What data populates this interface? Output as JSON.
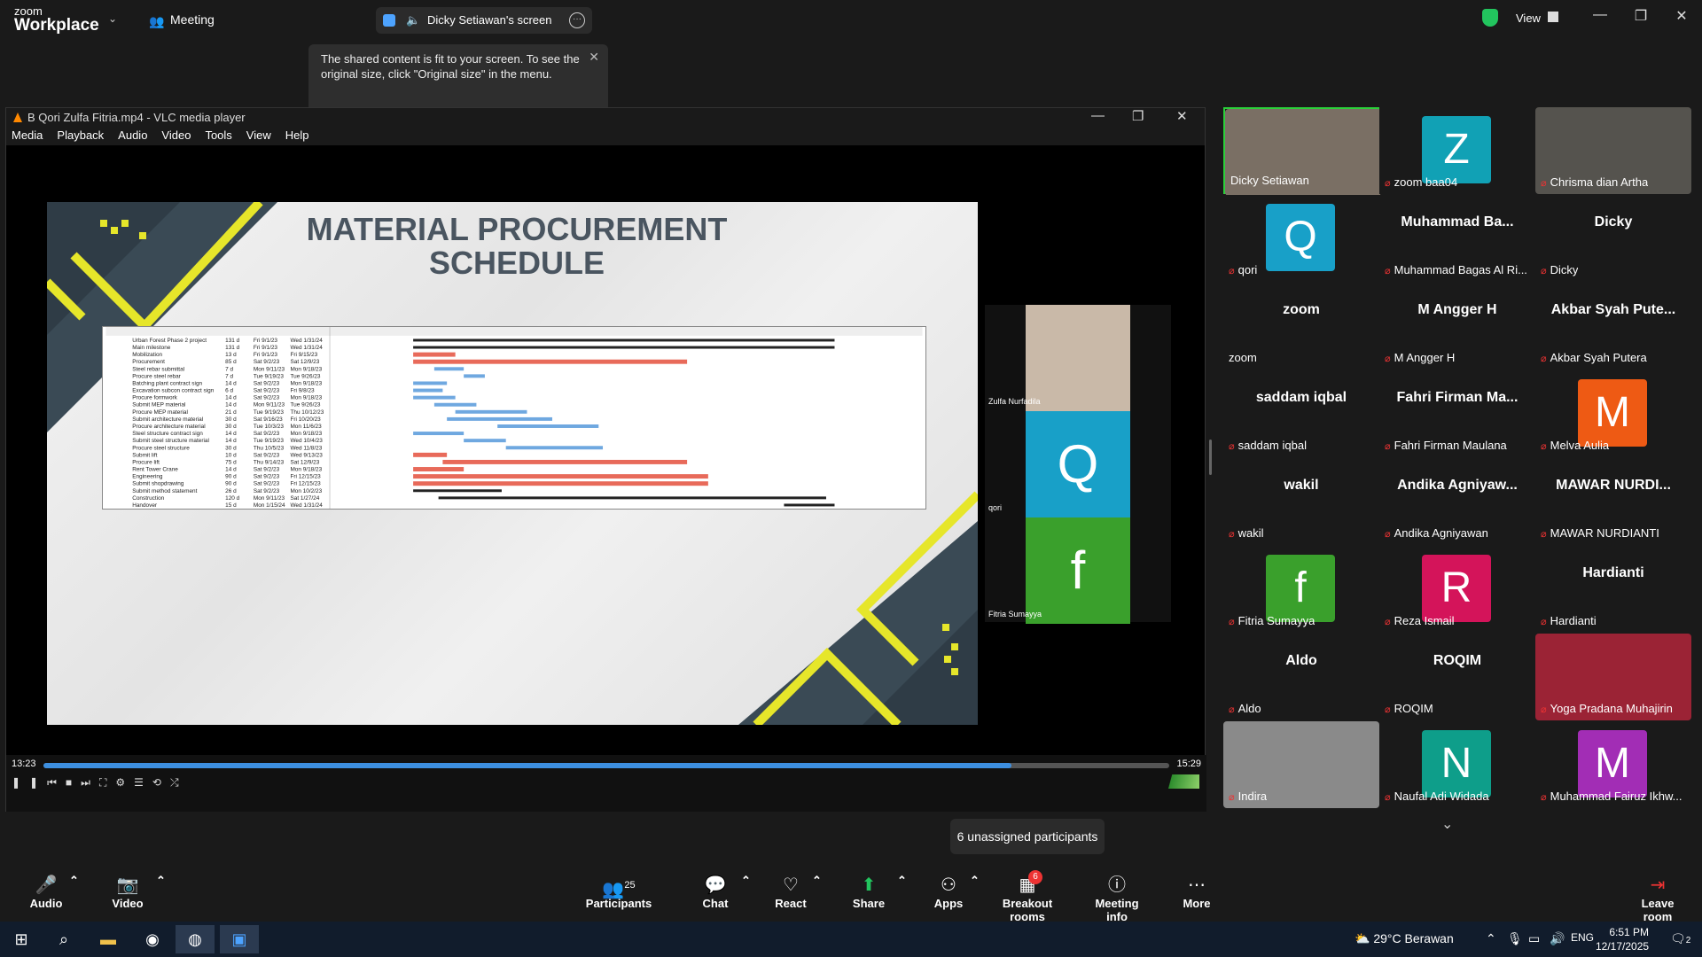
{
  "app": {
    "brand_small": "zoom",
    "brand_large": "Workplace",
    "meeting_label": "Meeting"
  },
  "share": {
    "title": "Dicky Setiawan's screen"
  },
  "top_right": {
    "view_label": "View"
  },
  "tooltip": {
    "text": "The shared content is fit to your screen. To see the original size, click \"Original size\" in the menu."
  },
  "vlc": {
    "title": "B Qori Zulfa Fitria.mp4 - VLC media player",
    "menu": [
      "Media",
      "Playback",
      "Audio",
      "Video",
      "Tools",
      "View",
      "Help"
    ],
    "time_elapsed": "13:23",
    "time_total": "15:29",
    "progress": 0.86,
    "volume": "79%"
  },
  "slide": {
    "title_line1": "MATERIAL PROCUREMENT",
    "title_line2": "SCHEDULE"
  },
  "gantt_rows": [
    {
      "name": "Urban Forest Phase 2 project",
      "dur": "131 d",
      "start": "Fri 9/1/23",
      "finish": "Wed 1/31/24"
    },
    {
      "name": "Main milestone",
      "dur": "131 d",
      "start": "Fri 9/1/23",
      "finish": "Wed 1/31/24"
    },
    {
      "name": "Mobilization",
      "dur": "13 d",
      "start": "Fri 9/1/23",
      "finish": "Fri 9/15/23"
    },
    {
      "name": "Procurement",
      "dur": "85 d",
      "start": "Sat 9/2/23",
      "finish": "Sat 12/9/23"
    },
    {
      "name": "Steel rebar submittal",
      "dur": "7 d",
      "start": "Mon 9/11/23",
      "finish": "Mon 9/18/23"
    },
    {
      "name": "Procure steel rebar",
      "dur": "7 d",
      "start": "Tue 9/19/23",
      "finish": "Tue 9/26/23"
    },
    {
      "name": "Batching plant contract sign",
      "dur": "14 d",
      "start": "Sat 9/2/23",
      "finish": "Mon 9/18/23"
    },
    {
      "name": "Excavation subcon contract sign",
      "dur": "6 d",
      "start": "Sat 9/2/23",
      "finish": "Fri 9/8/23"
    },
    {
      "name": "Procure formwork",
      "dur": "14 d",
      "start": "Sat 9/2/23",
      "finish": "Mon 9/18/23"
    },
    {
      "name": "Submit MEP material",
      "dur": "14 d",
      "start": "Mon 9/11/23",
      "finish": "Tue 9/26/23"
    },
    {
      "name": "Procure MEP material",
      "dur": "21 d",
      "start": "Tue 9/19/23",
      "finish": "Thu 10/12/23"
    },
    {
      "name": "Submit architecture material",
      "dur": "30 d",
      "start": "Sat 9/16/23",
      "finish": "Fri 10/20/23"
    },
    {
      "name": "Procure architecture material",
      "dur": "30 d",
      "start": "Tue 10/3/23",
      "finish": "Mon 11/6/23"
    },
    {
      "name": "Steel structure contract sign",
      "dur": "14 d",
      "start": "Sat 9/2/23",
      "finish": "Mon 9/18/23"
    },
    {
      "name": "Submit steel structure material",
      "dur": "14 d",
      "start": "Tue 9/19/23",
      "finish": "Wed 10/4/23"
    },
    {
      "name": "Procure steel structure",
      "dur": "30 d",
      "start": "Thu 10/5/23",
      "finish": "Wed 11/8/23"
    },
    {
      "name": "Submit lift",
      "dur": "10 d",
      "start": "Sat 9/2/23",
      "finish": "Wed 9/13/23"
    },
    {
      "name": "Procure lift",
      "dur": "75 d",
      "start": "Thu 9/14/23",
      "finish": "Sat 12/9/23"
    },
    {
      "name": "Rent Tower Crane",
      "dur": "14 d",
      "start": "Sat 9/2/23",
      "finish": "Mon 9/18/23"
    },
    {
      "name": "Engineering",
      "dur": "90 d",
      "start": "Sat 9/2/23",
      "finish": "Fri 12/15/23"
    },
    {
      "name": "Submit shopdrawing",
      "dur": "90 d",
      "start": "Sat 9/2/23",
      "finish": "Fri 12/15/23"
    },
    {
      "name": "Submit method statement",
      "dur": "26 d",
      "start": "Sat 9/2/23",
      "finish": "Mon 10/2/23"
    },
    {
      "name": "Construction",
      "dur": "120 d",
      "start": "Mon 9/11/23",
      "finish": "Sat 1/27/24"
    },
    {
      "name": "Handover",
      "dur": "15 d",
      "start": "Mon 1/15/24",
      "finish": "Wed 1/31/24"
    }
  ],
  "gantt_bars": [
    {
      "s": 0,
      "e": 1,
      "c": "#222",
      "h": 3
    },
    {
      "s": 0,
      "e": 1,
      "c": "#222",
      "h": 3
    },
    {
      "s": 0,
      "e": 0.1,
      "c": "#e86a5a",
      "h": 5
    },
    {
      "s": 0,
      "e": 0.65,
      "c": "#e86a5a",
      "h": 5
    },
    {
      "s": 0.05,
      "e": 0.12,
      "c": "#6fa8e0",
      "h": 4
    },
    {
      "s": 0.12,
      "e": 0.17,
      "c": "#6fa8e0",
      "h": 4
    },
    {
      "s": 0,
      "e": 0.08,
      "c": "#6fa8e0",
      "h": 4
    },
    {
      "s": 0,
      "e": 0.07,
      "c": "#6fa8e0",
      "h": 4
    },
    {
      "s": 0,
      "e": 0.1,
      "c": "#6fa8e0",
      "h": 4
    },
    {
      "s": 0.05,
      "e": 0.15,
      "c": "#6fa8e0",
      "h": 4
    },
    {
      "s": 0.1,
      "e": 0.27,
      "c": "#6fa8e0",
      "h": 4
    },
    {
      "s": 0.08,
      "e": 0.33,
      "c": "#6fa8e0",
      "h": 4
    },
    {
      "s": 0.2,
      "e": 0.44,
      "c": "#6fa8e0",
      "h": 4
    },
    {
      "s": 0,
      "e": 0.12,
      "c": "#6fa8e0",
      "h": 4
    },
    {
      "s": 0.12,
      "e": 0.22,
      "c": "#6fa8e0",
      "h": 4
    },
    {
      "s": 0.22,
      "e": 0.45,
      "c": "#6fa8e0",
      "h": 4
    },
    {
      "s": 0,
      "e": 0.08,
      "c": "#e86a5a",
      "h": 5
    },
    {
      "s": 0.07,
      "e": 0.65,
      "c": "#e86a5a",
      "h": 5
    },
    {
      "s": 0,
      "e": 0.12,
      "c": "#e86a5a",
      "h": 5
    },
    {
      "s": 0,
      "e": 0.7,
      "c": "#e86a5a",
      "h": 5
    },
    {
      "s": 0,
      "e": 0.7,
      "c": "#e86a5a",
      "h": 5
    },
    {
      "s": 0,
      "e": 0.21,
      "c": "#222",
      "h": 3
    },
    {
      "s": 0.06,
      "e": 0.98,
      "c": "#222",
      "h": 3
    },
    {
      "s": 0.88,
      "e": 1,
      "c": "#222",
      "h": 3
    }
  ],
  "speaker_strip": [
    {
      "name": "Zulfa Nurfadila",
      "initial": "",
      "color": "#c9b9a8"
    },
    {
      "name": "qori",
      "initial": "Q",
      "color": "#18a0c8"
    },
    {
      "name": "Fitria Sumayya",
      "initial": "f",
      "color": "#3aa02c"
    }
  ],
  "participants": [
    {
      "label": "Dicky Setiawan",
      "big": "",
      "initial": "",
      "color": "",
      "photo": "#7a6f64",
      "muted": false,
      "active": true
    },
    {
      "label": "zoom baa04",
      "big": "",
      "initial": "Z",
      "color": "#11a1b5",
      "photo": "",
      "muted": true
    },
    {
      "label": "Chrisma dian Artha",
      "big": "",
      "initial": "",
      "color": "",
      "photo": "#55534e",
      "muted": true
    },
    {
      "label": "qori",
      "big": "",
      "initial": "Q",
      "color": "#18a0c8",
      "photo": "",
      "muted": true
    },
    {
      "label": "Muhammad Bagas Al Ri...",
      "big": "Muhammad Ba...",
      "initial": "",
      "color": "",
      "photo": "",
      "muted": true
    },
    {
      "label": "Dicky",
      "big": "Dicky",
      "initial": "",
      "color": "",
      "photo": "",
      "muted": true
    },
    {
      "label": "zoom",
      "big": "zoom",
      "initial": "",
      "color": "",
      "photo": "",
      "muted": false
    },
    {
      "label": "M Angger H",
      "big": "M Angger H",
      "initial": "",
      "color": "",
      "photo": "",
      "muted": true
    },
    {
      "label": "Akbar Syah Putera",
      "big": "Akbar Syah Pute...",
      "initial": "",
      "color": "",
      "photo": "",
      "muted": true
    },
    {
      "label": "saddam iqbal",
      "big": "saddam iqbal",
      "initial": "",
      "color": "",
      "photo": "",
      "muted": true
    },
    {
      "label": "Fahri Firman Maulana",
      "big": "Fahri Firman Ma...",
      "initial": "",
      "color": "",
      "photo": "",
      "muted": true
    },
    {
      "label": "Melva Aulia",
      "big": "",
      "initial": "M",
      "color": "#ee5a14",
      "photo": "",
      "muted": true
    },
    {
      "label": "wakil",
      "big": "wakil",
      "initial": "",
      "color": "",
      "photo": "",
      "muted": true
    },
    {
      "label": "Andika Agniyawan",
      "big": "Andika Agniyaw...",
      "initial": "",
      "color": "",
      "photo": "",
      "muted": true
    },
    {
      "label": "MAWAR NURDIANTI",
      "big": "MAWAR NURDI...",
      "initial": "",
      "color": "",
      "photo": "",
      "muted": true
    },
    {
      "label": "Fitria Sumayya",
      "big": "",
      "initial": "f",
      "color": "#3aa02c",
      "photo": "",
      "muted": true
    },
    {
      "label": "Reza Ismail",
      "big": "",
      "initial": "R",
      "color": "#d4145a",
      "photo": "",
      "muted": true
    },
    {
      "label": "Hardianti",
      "big": "Hardianti",
      "initial": "",
      "color": "",
      "photo": "",
      "muted": true
    },
    {
      "label": "Aldo",
      "big": "Aldo",
      "initial": "",
      "color": "",
      "photo": "",
      "muted": true
    },
    {
      "label": "ROQIM",
      "big": "ROQIM",
      "initial": "",
      "color": "",
      "photo": "",
      "muted": true
    },
    {
      "label": "Yoga Pradana Muhajirin",
      "big": "",
      "initial": "",
      "color": "",
      "photo": "#9b2335",
      "muted": true
    },
    {
      "label": "Indira",
      "big": "",
      "initial": "",
      "color": "",
      "photo": "#8a8a8a",
      "muted": true
    },
    {
      "label": "Naufal Adi Widada",
      "big": "",
      "initial": "N",
      "color": "#0e9e8a",
      "photo": "",
      "muted": true
    },
    {
      "label": "Muhammad Fairuz Ikhw...",
      "big": "",
      "initial": "M",
      "color": "#a22db5",
      "photo": "",
      "muted": true
    }
  ],
  "toast": {
    "text": "6 unassigned participants"
  },
  "toolbar": {
    "audio": "Audio",
    "video": "Video",
    "participants": "Participants",
    "participants_count": "25",
    "chat": "Chat",
    "react": "React",
    "share": "Share",
    "apps": "Apps",
    "breakout": "Breakout rooms",
    "breakout_badge": "6",
    "info": "Meeting info",
    "more": "More",
    "leave": "Leave room"
  },
  "taskbar": {
    "weather": "29°C Berawan",
    "lang": "ENG",
    "time": "6:51 PM",
    "date": "12/17/2025",
    "notif": "2"
  },
  "colors": {
    "accent": "#0b5cff",
    "mute": "#e33333",
    "share_green": "#22c55e"
  }
}
